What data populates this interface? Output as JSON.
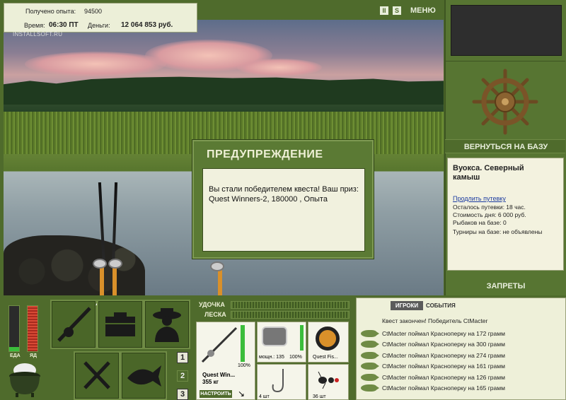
{
  "hud": {
    "exp_label": "Получено опыта:",
    "exp_value": "94500",
    "time_label": "Время:",
    "time_value": "06:30 ПТ",
    "money_label": "Деньги:",
    "money_value": "12 064 853 руб.",
    "watermark": "INSTALLSOFT.RU"
  },
  "top_icons": {
    "pause": "II",
    "sound": "S",
    "menu": "МЕНЮ"
  },
  "dialog": {
    "title": "ПРЕДУПРЕЖДЕНИЕ",
    "message": "Вы стали победителем квеста! Ваш приз: Quest Winners-2, 180000 , Опыта"
  },
  "right_panel": {
    "return_label": "ВЕРНУТЬСЯ НА БАЗУ",
    "location_name": "Вуокса. Северный камыш",
    "extend_link": "Продлить путевку",
    "remaining": "Осталось путевки: 18 час.",
    "day_cost": "Стоимость дня: 6 000 руб.",
    "fishers": "Рыбаков на базе: 0",
    "tournaments": "Турниры на базе: не объявлены",
    "bans_label": "ЗАПРЕТЫ"
  },
  "bottom": {
    "food_label": "ЕДА",
    "poison_label": "ЯД",
    "page_buttons": [
      "1",
      "2",
      "3"
    ],
    "rod_label": "УДОЧКА",
    "line_label": "ЛЕСКА",
    "rod_name": "Quest Win...",
    "rod_weight": "355 кг",
    "rod_percent": "100%",
    "setup_label": "НАСТРОИТЬ",
    "reel_power": "мощн.: 135",
    "reel_percent": "100%",
    "line_name": "Quest Fis...",
    "hook_count": "4 шт",
    "bait_count": "36 шт"
  },
  "events": {
    "tab_players": "ИГРОКИ",
    "tab_events": "СОБЫТИЯ",
    "quest_done": "Квест закончен! Победитель CtMacter",
    "rows": [
      "CtMacter поймал Красноперку на 172 грамм",
      "CtMacter поймал Красноперку на 300 грамм",
      "CtMacter поймал Красноперку на 274 грамм",
      "CtMacter поймал Красноперку на 161 грамм",
      "CtMacter поймал Красноперку на 126 грамм",
      "CtMacter поймал Красноперку на 165 грамм"
    ]
  },
  "colors": {
    "panel_green": "#577532",
    "frame_green": "#6f8b45",
    "title_text": "#e8eedc",
    "food_bar": "#3bbd3b",
    "poison_bar": "#cc3a2a"
  }
}
